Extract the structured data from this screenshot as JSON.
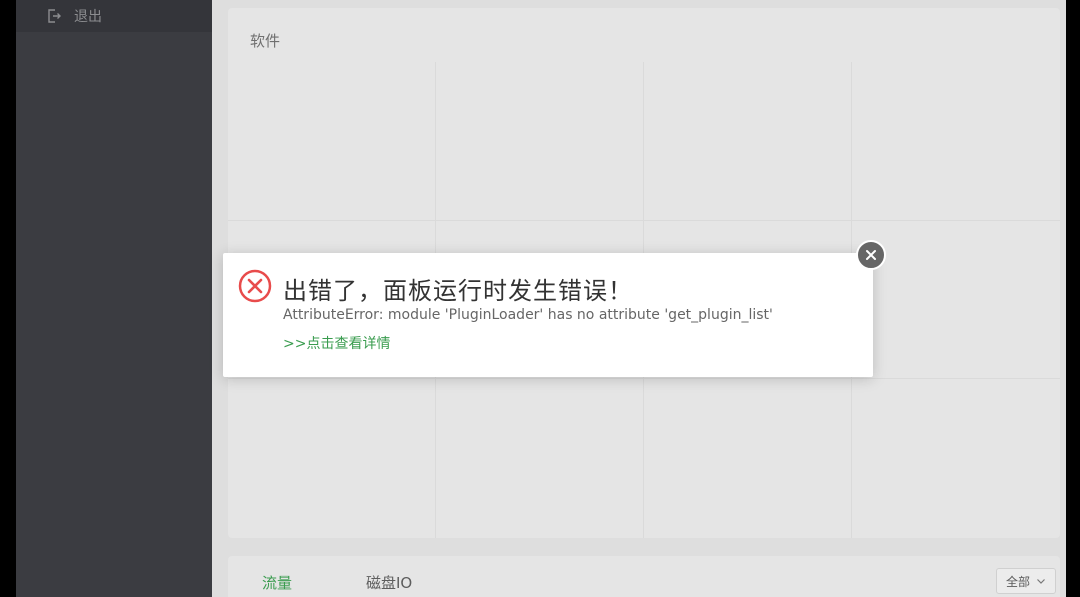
{
  "sidebar": {
    "logout_label": "退出",
    "logout_icon": "logout-icon"
  },
  "software_panel": {
    "title": "软件"
  },
  "bottom_panel": {
    "tabs": [
      {
        "label": "流量",
        "active": true
      },
      {
        "label": "磁盘IO",
        "active": false
      }
    ],
    "filter": {
      "selected": "全部",
      "icon": "chevron-down-icon"
    }
  },
  "error_dialog": {
    "icon": "error-x-icon",
    "title": "出错了，面板运行时发生错误！",
    "message": "AttributeError: module 'PluginLoader' has no attribute 'get_plugin_list'",
    "details_link": ">>点击查看详情",
    "close_icon": "close-icon"
  },
  "colors": {
    "accent_green": "#3a9c4f",
    "error_red": "#e84b4b",
    "sidebar_bg": "#3b3c41"
  }
}
